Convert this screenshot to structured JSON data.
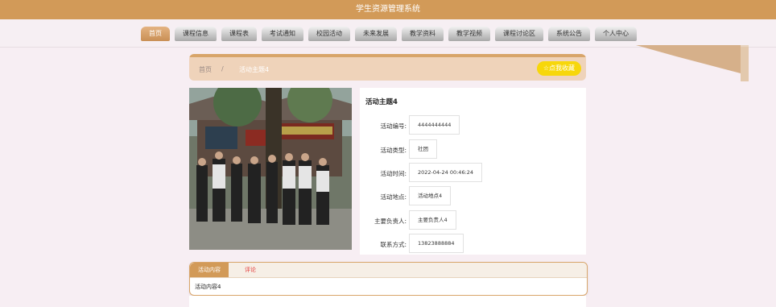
{
  "header": {
    "title": "学生资源管理系统"
  },
  "nav": {
    "items": [
      {
        "label": "首页",
        "active": true
      },
      {
        "label": "课程信息"
      },
      {
        "label": "课程表"
      },
      {
        "label": "考试通知"
      },
      {
        "label": "校园活动"
      },
      {
        "label": "未来发展"
      },
      {
        "label": "教学资料"
      },
      {
        "label": "教学视频"
      },
      {
        "label": "课程讨论区"
      },
      {
        "label": "系统公告"
      },
      {
        "label": "个人中心"
      }
    ]
  },
  "breadcrumb": {
    "home": "首页",
    "separator": "/",
    "current": "活动主题4"
  },
  "favorite": {
    "icon": "star-icon",
    "label": "☆点我收藏",
    "color": "#f7d70a"
  },
  "detail": {
    "title": "活动主题4",
    "fields": [
      {
        "label": "活动编号:",
        "value": "4444444444"
      },
      {
        "label": "活动类型:",
        "value": "社团"
      },
      {
        "label": "活动时间:",
        "value": "2022-04-24 00:46:24"
      },
      {
        "label": "活动地点:",
        "value": "活动地点4"
      },
      {
        "label": "主要负责人:",
        "value": "主要负责人4"
      },
      {
        "label": "联系方式:",
        "value": "13823888884"
      }
    ]
  },
  "tabs": {
    "items": [
      {
        "label": "活动内容",
        "active": true
      },
      {
        "label": "评论"
      }
    ],
    "content": "活动内容4"
  },
  "colors": {
    "accent": "#d29a58",
    "breadcrumb": "#efd3ba",
    "background": "#f7eef3"
  }
}
